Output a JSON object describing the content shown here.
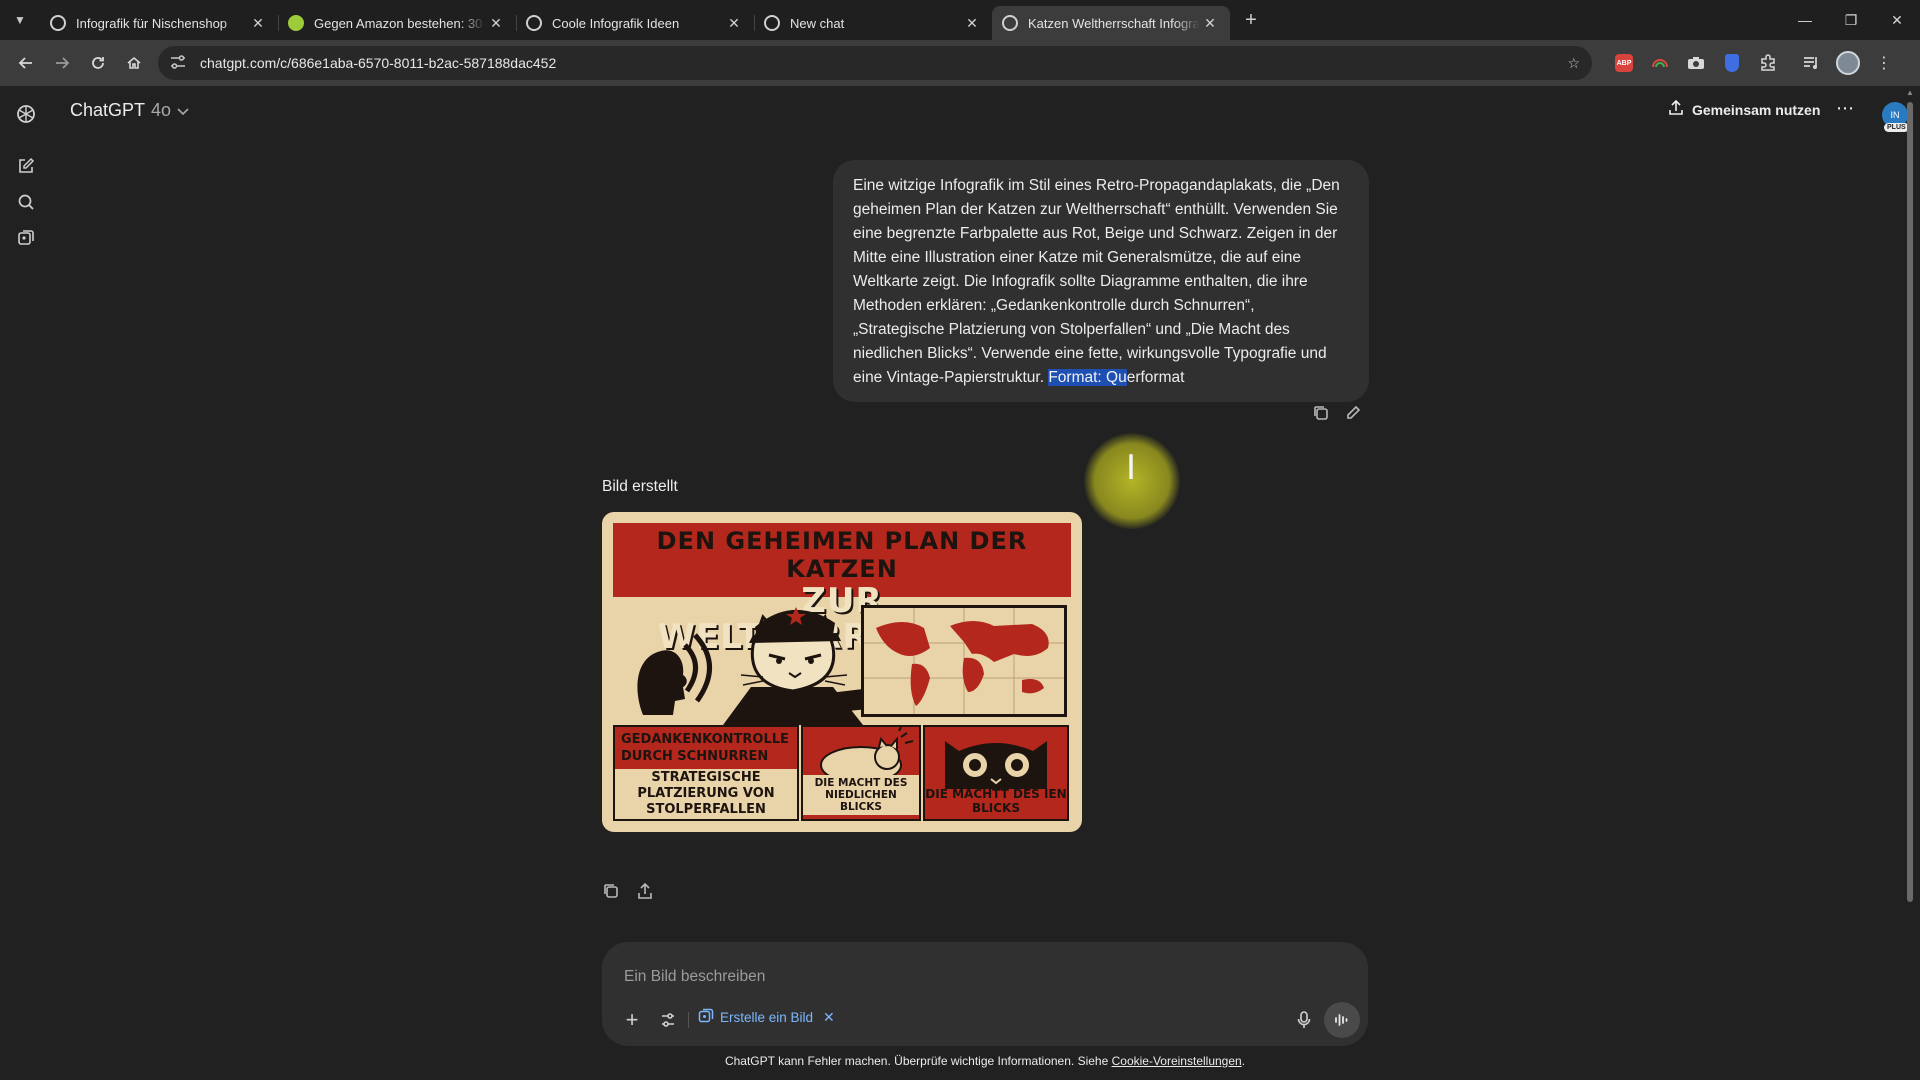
{
  "browser": {
    "tabs": [
      {
        "title": "Infografik für Nischenshop",
        "icon": "chatgpt-favicon"
      },
      {
        "title": "Gegen Amazon bestehen: 30 Ti",
        "icon": "green-favicon"
      },
      {
        "title": "Coole Infografik Ideen",
        "icon": "chatgpt-favicon"
      },
      {
        "title": "New chat",
        "icon": "chatgpt-favicon"
      },
      {
        "title": "Katzen Weltherrschaft Infografik",
        "icon": "chatgpt-favicon",
        "active": true
      }
    ],
    "url": "chatgpt.com/c/686e1aba-6570-8011-b2ac-587188dac452",
    "extensions": [
      "abp-icon",
      "rainbow-icon",
      "camera-icon",
      "bitwarden-shield-icon",
      "puzzle-icon",
      "media-icon",
      "profile-icon"
    ],
    "abp_label": "ABP"
  },
  "header": {
    "model_name": "ChatGPT",
    "model_version": "4o",
    "share_label": "Gemeinsam nutzen",
    "avatar_initials": "IN",
    "plan_badge": "PLUS"
  },
  "conversation": {
    "user_message_before": "Eine witzige Infografik im Stil eines Retro-Propagandaplakats, die „Den geheimen Plan der Katzen zur Weltherrschaft“ enthüllt. Verwenden Sie eine begrenzte Farbpalette aus Rot, Beige und Schwarz. Zeigen in der Mitte eine Illustration einer Katze mit Generalsmütze, die auf eine Weltkarte zeigt. Die Infografik sollte Diagramme enthalten, die ihre Methoden erklären: „Gedankenkontrolle durch Schnurren“, „Strategische Platzierung von Stolperfallen“ und „Die Macht des niedlichen Blicks“. Verwende eine fette, wirkungsvolle Typografie und eine Vintage-Papierstruktur. ",
    "user_message_highlight": "Format: Qu",
    "user_message_after": "erformat",
    "assistant_status": "Bild erstellt",
    "poster": {
      "title_line1": "DEN GEHEIMEN PLAN DER KATZEN",
      "title_line2": "ZUR WELTHERRSCHAFT",
      "panel1": "GEDANKENKONTROLLE DURCH SCHNURREN",
      "panel2": "STRATEGISCHE PLATZIERUNG VON STOLPERFALLEN",
      "panel3": "DIE MACHT DES NIEDLICHEN BLICKS",
      "panel4": "DIE MACHTT DES IEN BLICKS"
    }
  },
  "composer": {
    "placeholder": "Ein Bild beschreiben",
    "chip_label": "Erstelle ein Bild"
  },
  "footer": {
    "note": "ChatGPT kann Fehler machen. Überprüfe wichtige Informationen. Siehe ",
    "link": "Cookie-Voreinstellungen",
    "note_end": "."
  },
  "colors": {
    "background": "#212121",
    "bubble": "#303030",
    "highlight": "#1e4fb3",
    "poster_red": "#b3271c",
    "poster_beige": "#e9d3a9",
    "chip_blue": "#7ab7ff"
  }
}
